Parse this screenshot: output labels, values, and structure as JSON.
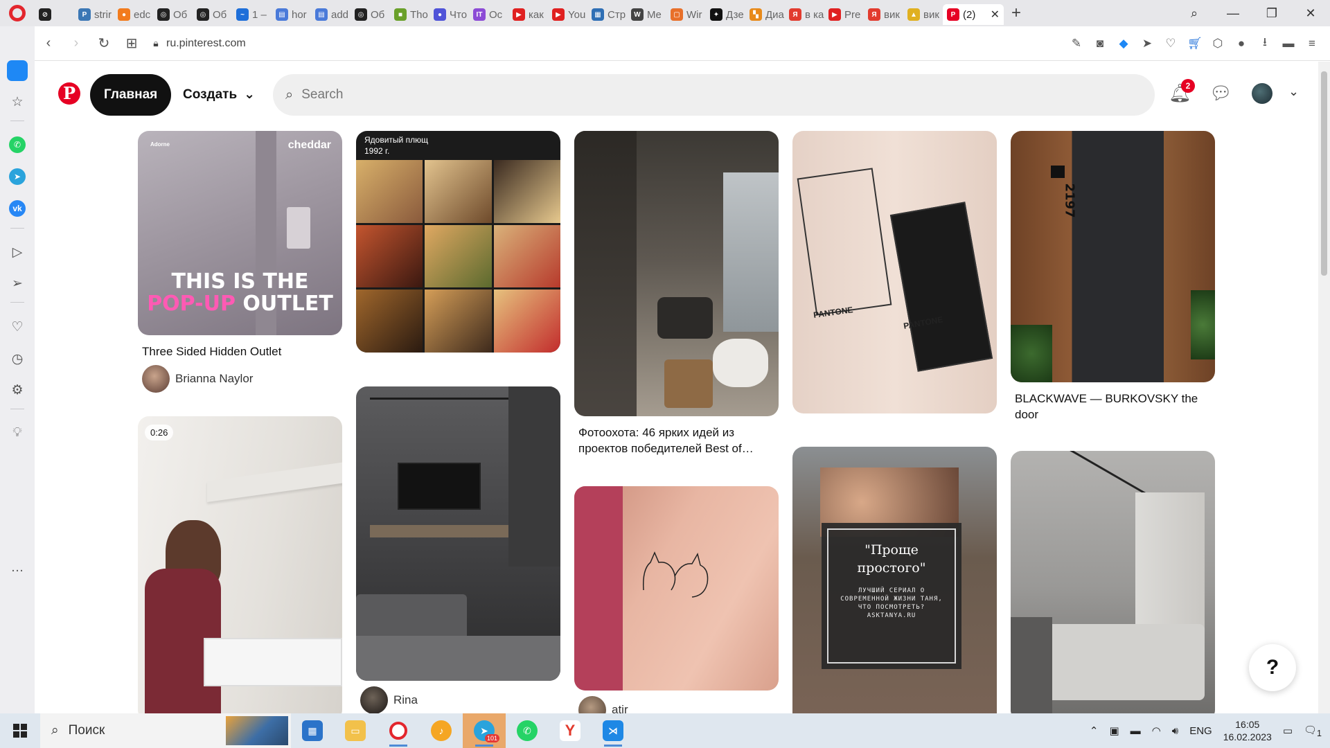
{
  "browser": {
    "tabs": [
      {
        "title": "",
        "color": "#222222",
        "glyph": "⊘"
      },
      {
        "title": "strir",
        "color": "#3b77b5",
        "glyph": "P"
      },
      {
        "title": "edc",
        "color": "#f27b1d",
        "glyph": "●"
      },
      {
        "title": "Об",
        "color": "#222222",
        "glyph": "◎"
      },
      {
        "title": "Об",
        "color": "#222222",
        "glyph": "◎"
      },
      {
        "title": "1 –",
        "color": "#1e6fd9",
        "glyph": "~"
      },
      {
        "title": "hor",
        "color": "#4a7ad9",
        "glyph": "▤"
      },
      {
        "title": "add",
        "color": "#4a7ad9",
        "glyph": "▤"
      },
      {
        "title": "Об",
        "color": "#222222",
        "glyph": "◎"
      },
      {
        "title": "Tho",
        "color": "#6aa02a",
        "glyph": "■"
      },
      {
        "title": "Что",
        "color": "#4f53d8",
        "glyph": "●"
      },
      {
        "title": "Oc",
        "color": "#8c4bd6",
        "glyph": "IT"
      },
      {
        "title": "как",
        "color": "#e02020",
        "glyph": "▶"
      },
      {
        "title": "You",
        "color": "#e02020",
        "glyph": "▶"
      },
      {
        "title": "Стр",
        "color": "#2f6fb5",
        "glyph": "▦"
      },
      {
        "title": "Me",
        "color": "#444444",
        "glyph": "W"
      },
      {
        "title": "Wir",
        "color": "#e8702a",
        "glyph": "▢"
      },
      {
        "title": "Дзе",
        "color": "#111111",
        "glyph": "✦"
      },
      {
        "title": "Диа",
        "color": "#e88a1a",
        "glyph": "▚"
      },
      {
        "title": "в ка",
        "color": "#e23b2e",
        "glyph": "Я"
      },
      {
        "title": "Pre",
        "color": "#e02020",
        "glyph": "▶"
      },
      {
        "title": "вик",
        "color": "#e23b2e",
        "glyph": "Я"
      },
      {
        "title": "вик",
        "color": "#e0b020",
        "glyph": "▲"
      },
      {
        "title": "(2)",
        "color": "#e60023",
        "glyph": "P",
        "active": true
      }
    ],
    "url": "ru.pinterest.com"
  },
  "pinterest": {
    "home_label": "Главная",
    "create_label": "Создать",
    "search_placeholder": "Search",
    "notification_count": "2",
    "help_label": "?"
  },
  "pins": {
    "p1": {
      "overlay_brand": "cheddar",
      "overlay_small": "Adorne",
      "overlay_line1": "THIS IS THE",
      "overlay_line2a": "POP-UP",
      "overlay_line2b": " OUTLET",
      "title": "Three Sided Hidden Outlet",
      "author": "Brianna Naylor"
    },
    "p2": {
      "video_time": "0:26"
    },
    "p3": {
      "overlay_line1": "Ядовитый плющ",
      "overlay_line2": "1992 г."
    },
    "p4": {
      "author": "Rina"
    },
    "p5": {
      "title": "Фотоохота: 46 ярких идей из проектов победителей Best of…"
    },
    "p6": {
      "author": "atir"
    },
    "p7": {
      "label_left": "PANTONE",
      "label_right": "PANTONE"
    },
    "p8": {
      "quote": "\"Проще простого\"",
      "caption": "ЛУЧШИЙ СЕРИАЛ О СОВРЕМЕННОЙ ЖИЗНИ ТАНЯ, ЧТО ПОСМОТРЕТЬ? ASKTANYA.RU"
    },
    "p9": {
      "title": "BLACKWAVE — BURKOVSKY the door",
      "door_number": "2197"
    }
  },
  "taskbar": {
    "search_label": "Поиск",
    "telegram_badge": "101",
    "language": "ENG",
    "time": "16:05",
    "date": "16.02.2023",
    "notif_count": "1"
  }
}
